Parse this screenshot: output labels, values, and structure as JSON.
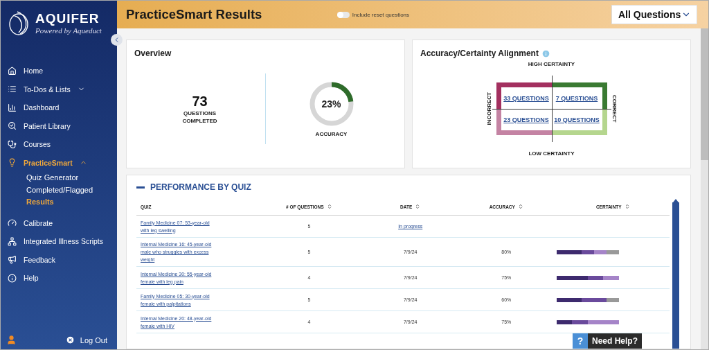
{
  "sidebar": {
    "brand": "AQUIFER",
    "tagline": "Powered by Aqueduct",
    "items": [
      {
        "label": "Home",
        "selected": false
      },
      {
        "label": "To-Dos & Lists",
        "selected": false,
        "expanded": false
      },
      {
        "label": "Dashboard",
        "selected": false
      },
      {
        "label": "Patient Library",
        "selected": false
      },
      {
        "label": "Courses",
        "selected": false
      },
      {
        "label": "PracticeSmart",
        "selected": true,
        "expanded": true,
        "children": [
          {
            "label": "Quiz Generator",
            "selected": false
          },
          {
            "label": "Completed/Flagged",
            "selected": false
          },
          {
            "label": "Results",
            "selected": true
          }
        ]
      },
      {
        "label": "Calibrate",
        "selected": false
      },
      {
        "label": "Integrated Illness Scripts",
        "selected": false
      },
      {
        "label": "Feedback",
        "selected": false
      },
      {
        "label": "Help",
        "selected": false
      }
    ],
    "logout": "Log Out"
  },
  "header": {
    "title": "PracticeSmart Results",
    "toggle": {
      "label": "Include reset questions",
      "on": false
    },
    "filter": "All Questions"
  },
  "overview": {
    "title": "Overview",
    "completed": {
      "value": "73",
      "label": "QUESTIONS COMPLETED"
    },
    "accuracy": {
      "value": "23%",
      "label": "ACCURACY",
      "level": 0.23
    }
  },
  "alignment": {
    "title": "Accuracy/Certainty Alignment",
    "top": "HIGH CERTAINTY",
    "bottom": "LOW CERTAINTY",
    "left": "INCORRECT",
    "right": "CORRECT",
    "quadrants": [
      {
        "label": "33 QUESTIONS",
        "color": "#a3305f"
      },
      {
        "label": "7 QUESTIONS",
        "color": "#3a7a32"
      },
      {
        "label": "23 QUESTIONS",
        "color": "#c483a3"
      },
      {
        "label": "10 QUESTIONS",
        "color": "#b5d68e"
      }
    ]
  },
  "performance": {
    "title": "PERFORMANCE BY QUIZ",
    "columns": [
      "QUIZ",
      "# OF QUESTIONS",
      "DATE",
      "ACCURACY",
      "CERTAINTY"
    ],
    "rows": [
      {
        "kind": "in_progress",
        "quiz": "Family Medicine 07: 53-year-old with leg swelling",
        "questions": "5",
        "date": "In progress"
      },
      {
        "kind": "completed",
        "quiz": "Internal Medicine 16: 45-year-old male who struggles with excess weight",
        "questions": "5",
        "date": "7/9/24",
        "accuracy": "80%",
        "certainty": [
          {
            "kind": "high"
          },
          {
            "kind": "high"
          },
          {
            "kind": "medium"
          },
          {
            "kind": "low"
          },
          {
            "kind": "none"
          }
        ]
      },
      {
        "kind": "completed",
        "quiz": "Internal Medicine 30: 55-year-old female with leg pain",
        "questions": "4",
        "date": "7/9/24",
        "accuracy": "75%",
        "certainty": [
          {
            "kind": "high"
          },
          {
            "kind": "high"
          },
          {
            "kind": "medium"
          },
          {
            "kind": "low"
          }
        ]
      },
      {
        "kind": "completed",
        "quiz": "Family Medicine 05: 30-year-old female with palpitations",
        "questions": "5",
        "date": "7/9/24",
        "accuracy": "60%",
        "certainty": [
          {
            "kind": "high"
          },
          {
            "kind": "high"
          },
          {
            "kind": "medium"
          },
          {
            "kind": "medium"
          },
          {
            "kind": "none"
          }
        ]
      },
      {
        "kind": "completed",
        "quiz": "Internal Medicine 20: 48-year-old female with HIV",
        "questions": "4",
        "date": "7/9/24",
        "accuracy": "75%",
        "certainty": [
          {
            "kind": "high"
          },
          {
            "kind": "medium"
          },
          {
            "kind": "low"
          },
          {
            "kind": "low"
          }
        ]
      }
    ]
  },
  "help_button": {
    "icon": "?",
    "label": "Need Help?"
  }
}
